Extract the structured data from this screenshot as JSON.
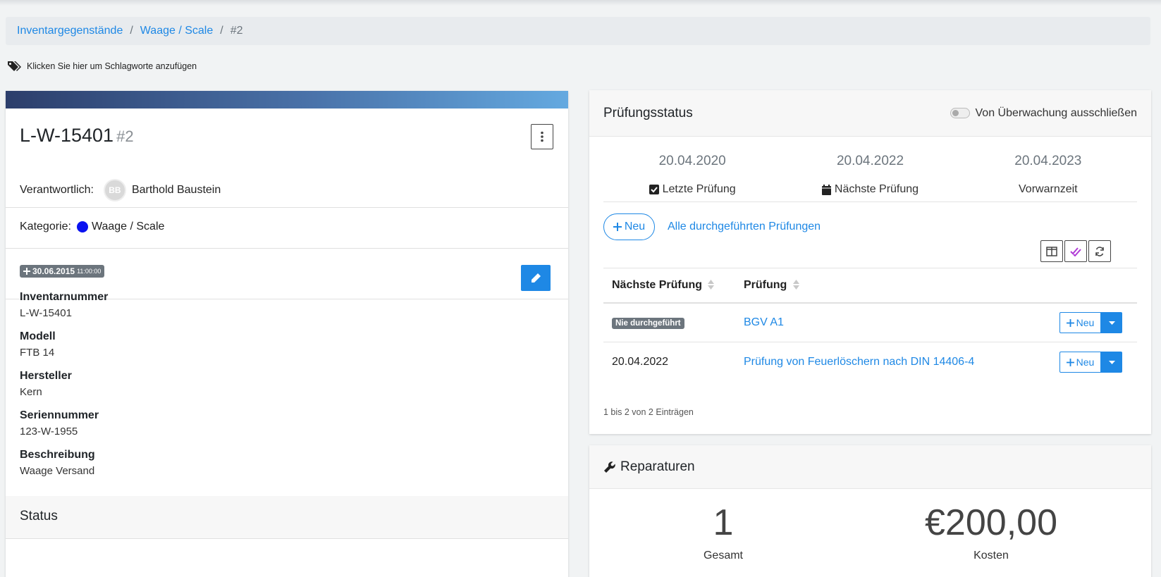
{
  "breadcrumb": {
    "item1": "Inventargegenstände",
    "item2": "Waage / Scale",
    "current": "#2",
    "sep": "/"
  },
  "tags": {
    "text": "Klicken Sie hier um Schlagworte anzufügen",
    "icon": "tags-icon"
  },
  "item": {
    "title": "L-W-15401",
    "number": "#2",
    "responsible_label": "Verantwortlich:",
    "avatar_initials": "BB",
    "responsible_name": "Barthold Baustein",
    "category_label": "Kategorie:",
    "category_name": "Waage / Scale",
    "category_color": "#0a12f0",
    "created_date": "30.06.2015",
    "created_time": "11:00:00",
    "fields": [
      {
        "label": "Inventarnummer",
        "value": "L-W-15401"
      },
      {
        "label": "Modell",
        "value": "FTB 14"
      },
      {
        "label": "Hersteller",
        "value": "Kern"
      },
      {
        "label": "Seriennummer",
        "value": "123-W-1955"
      },
      {
        "label": "Beschreibung",
        "value": "Waage Versand"
      }
    ],
    "status_title": "Status"
  },
  "inspection": {
    "title": "Prüfungsstatus",
    "exclude_label": "Von Überwachung ausschließen",
    "exclude_enabled": false,
    "dates": [
      {
        "date": "20.04.2020",
        "label": "Letzte Prüfung",
        "icon": "check-square-icon"
      },
      {
        "date": "20.04.2022",
        "label": "Nächste Prüfung",
        "icon": "calendar-icon"
      },
      {
        "date": "20.04.2023",
        "label": "Vorwarnzeit",
        "icon": ""
      }
    ],
    "new_label": "Neu",
    "all_link": "Alle durchgeführten Prüfungen",
    "columns": [
      "Nächste Prüfung",
      "Prüfung"
    ],
    "rows": [
      {
        "next": "Nie durchgeführt",
        "next_is_badge": true,
        "name": "BGV A1",
        "button": "Neu"
      },
      {
        "next": "20.04.2022",
        "next_is_badge": false,
        "name": "Prüfung von Feuerlöschern nach DIN 14406-4",
        "button": "Neu"
      }
    ],
    "info": "1 bis 2 von 2 Einträgen"
  },
  "repairs": {
    "title": "Reparaturen",
    "total_value": "1",
    "total_label": "Gesamt",
    "cost_value": "€200,00",
    "cost_label": "Kosten"
  },
  "colors": {
    "accent": "#1e88e5",
    "badge": "#6c757d"
  }
}
